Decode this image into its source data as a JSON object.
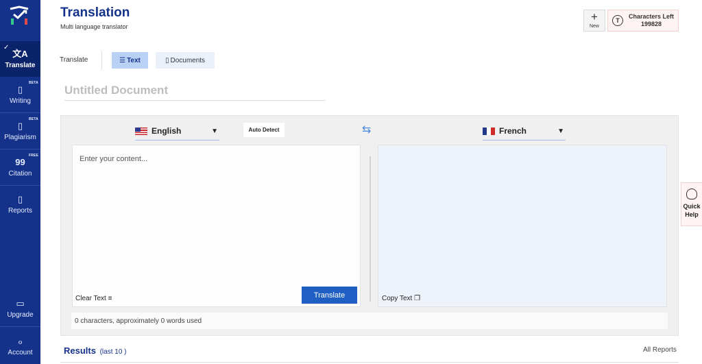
{
  "header": {
    "title": "Translation",
    "subtitle": "Multi language translator",
    "new_label": "New",
    "chars_label": "Characters Left",
    "chars_value": "199828"
  },
  "sidebar": {
    "items": [
      {
        "label": "Translate",
        "icon": "translate-icon",
        "badge": ""
      },
      {
        "label": "Writing",
        "icon": "writing-icon",
        "badge": "BETA"
      },
      {
        "label": "Plagiarism",
        "icon": "plagiarism-icon",
        "badge": "BETA"
      },
      {
        "label": "Citation",
        "icon": "quote-icon",
        "badge": "FREE"
      },
      {
        "label": "Reports",
        "icon": "reports-icon",
        "badge": ""
      }
    ],
    "upgrade_label": "Upgrade",
    "account_label": "Account"
  },
  "tabs": {
    "label": "Translate",
    "text_label": "Text",
    "documents_label": "Documents"
  },
  "document": {
    "title": "Untitled Document"
  },
  "translator": {
    "source_language": "English",
    "target_language": "French",
    "auto_detect_label": "Auto Detect",
    "placeholder": "Enter your content...",
    "clear_label": "Clear Text",
    "translate_label": "Translate",
    "copy_label": "Copy Text",
    "stats": "0 characters, approximately 0 words used"
  },
  "quick_help": {
    "line1": "Quick",
    "line2": "Help"
  },
  "results": {
    "title": "Results",
    "subtitle": "(last 10 )",
    "all_reports_label": "All Reports"
  },
  "colors": {
    "sidebar": "#14328a",
    "accent": "#1f5fc4",
    "title": "#14328a"
  }
}
